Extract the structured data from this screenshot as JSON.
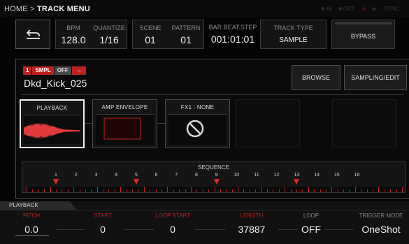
{
  "breadcrumb": {
    "home": "HOME",
    "sep": ">",
    "current": "TRACK MENU"
  },
  "indicators": {
    "in": "IN",
    "out": "OUT",
    "sync": "SYNC"
  },
  "header": {
    "bpm": {
      "label": "BPM",
      "value": "128.0"
    },
    "quantize": {
      "label": "QUANTIZE",
      "value": "1/16"
    },
    "scene": {
      "label": "SCENE",
      "value": "01"
    },
    "pattern": {
      "label": "PATTERN",
      "value": "01"
    },
    "barbeat": {
      "label": "BAR.BEAT.STEP",
      "value": "001:01:01"
    },
    "tracktype": {
      "label": "TRACK TYPE",
      "value": "SAMPLE"
    },
    "bypass": "BYPASS"
  },
  "track": {
    "number": "1",
    "type": "SMPL",
    "state": "OFF",
    "arrow": "→",
    "sample_name": "Dkd_Kick_025",
    "browse": "BROWSE",
    "sampling_edit": "SAMPLING/EDIT"
  },
  "modules": {
    "playback": "PLAYBACK",
    "amp": "AMP ENVELOPE",
    "fx": "FX1 : NONE"
  },
  "sequence": {
    "title": "SEQUENCE",
    "steps": [
      "1",
      "2",
      "3",
      "4",
      "5",
      "6",
      "7",
      "8",
      "9",
      "10",
      "11",
      "12",
      "13",
      "14",
      "15",
      "16"
    ],
    "active": [
      1,
      5,
      9,
      13
    ]
  },
  "bottom": {
    "tab": "PLAYBACK",
    "params": [
      {
        "label": "PITCH",
        "value": "0.0",
        "color": "#c02020"
      },
      {
        "label": "START",
        "value": "0",
        "color": "#c02020"
      },
      {
        "label": "LOOP START",
        "value": "0",
        "color": "#c02020"
      },
      {
        "label": "LENGTH",
        "value": "37887",
        "color": "#c02020"
      },
      {
        "label": "LOOP",
        "value": "OFF",
        "color": "#8a8a8a"
      },
      {
        "label": "TRIGGER MODE",
        "value": "OneShot",
        "color": "#8a8a8a"
      }
    ]
  },
  "colors": {
    "accent": "#c02020",
    "marker": "#e02828"
  }
}
